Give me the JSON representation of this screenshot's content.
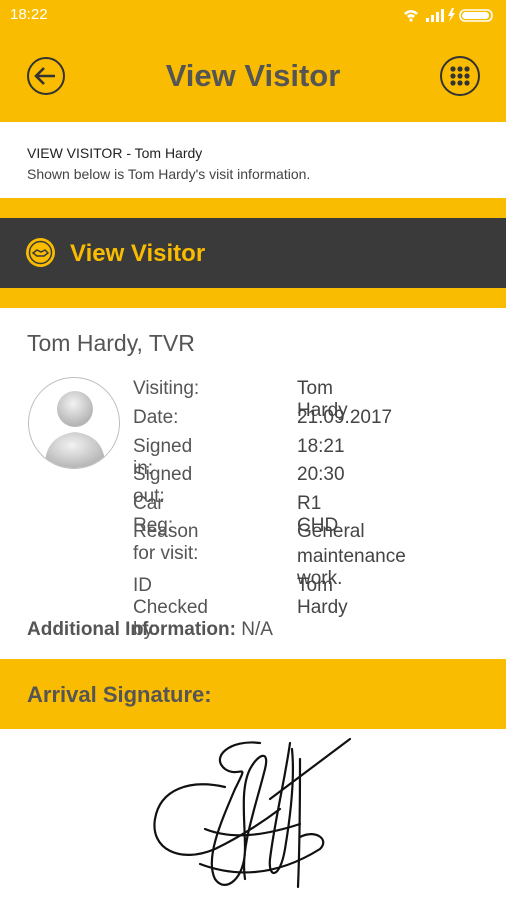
{
  "status_bar": {
    "time": "18:22",
    "icons": [
      "wifi-icon",
      "signal-icon",
      "charging-icon",
      "battery-icon"
    ]
  },
  "app_bar": {
    "title": "View Visitor",
    "back_icon": "back-arrow-icon",
    "menu_icon": "grid-menu-icon"
  },
  "info_header": {
    "heading": "VIEW VISITOR - Tom Hardy",
    "description": "Shown below is Tom Hardy's visit information."
  },
  "section_bar": {
    "label": "View Visitor",
    "icon": "handshake-logo-icon"
  },
  "visitor": {
    "name_line": "Tom Hardy, TVR",
    "details": [
      {
        "label": "Visiting:",
        "value": "Tom Hardy"
      },
      {
        "label": "Date:",
        "value": "21.09.2017"
      },
      {
        "label": "Signed in:",
        "value": "18:21"
      },
      {
        "label": "Signed out:",
        "value": "20:30"
      },
      {
        "label": "Car Reg:",
        "value": "R1 CHD"
      },
      {
        "label": "Reason for visit:",
        "value_line1": "General",
        "value_line2": "maintenance work."
      },
      {
        "label": "ID Checked by:",
        "value": "Tom Hardy"
      }
    ],
    "additional_label": "Additional Information:",
    "additional_value": "N/A"
  },
  "signature": {
    "label": "Arrival Signature:"
  },
  "colors": {
    "accent": "#f9bc00",
    "dark": "#3a3a3a",
    "text": "#555555"
  }
}
